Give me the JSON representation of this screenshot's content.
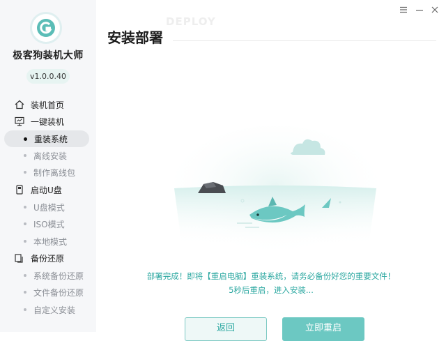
{
  "app": {
    "name": "极客狗装机大师",
    "version": "v1.0.0.40"
  },
  "window_controls": {
    "menu_icon": "menu-icon",
    "minimize_icon": "minimize-icon"
  },
  "sidebar": {
    "items": [
      {
        "label": "装机首页",
        "icon": "home-icon",
        "type": "section"
      },
      {
        "label": "一键装机",
        "icon": "monitor-icon",
        "type": "section"
      },
      {
        "label": "重装系统",
        "type": "sub",
        "active": true
      },
      {
        "label": "离线安装",
        "type": "sub"
      },
      {
        "label": "制作离线包",
        "type": "sub"
      },
      {
        "label": "启动U盘",
        "icon": "usb-icon",
        "type": "section"
      },
      {
        "label": "U盘模式",
        "type": "sub"
      },
      {
        "label": "ISO模式",
        "type": "sub"
      },
      {
        "label": "本地模式",
        "type": "sub"
      },
      {
        "label": "备份还原",
        "icon": "backup-icon",
        "type": "section"
      },
      {
        "label": "系统备份还原",
        "type": "sub"
      },
      {
        "label": "文件备份还原",
        "type": "sub"
      },
      {
        "label": "自定义安装",
        "type": "sub"
      }
    ]
  },
  "main": {
    "title": "安装部署",
    "ghost_text": "DEPLOY",
    "message_line1": "部署完成！即将【重启电脑】重装系统，请务必备份好您的重要文件！",
    "message_line2": "5秒后重启，进入安装...",
    "buttons": {
      "back": "返回",
      "restart": "立即重启"
    }
  },
  "colors": {
    "accent": "#2aa7a0",
    "button_primary": "#6cc8c2",
    "sidebar_bg": "#f6f7f9"
  }
}
